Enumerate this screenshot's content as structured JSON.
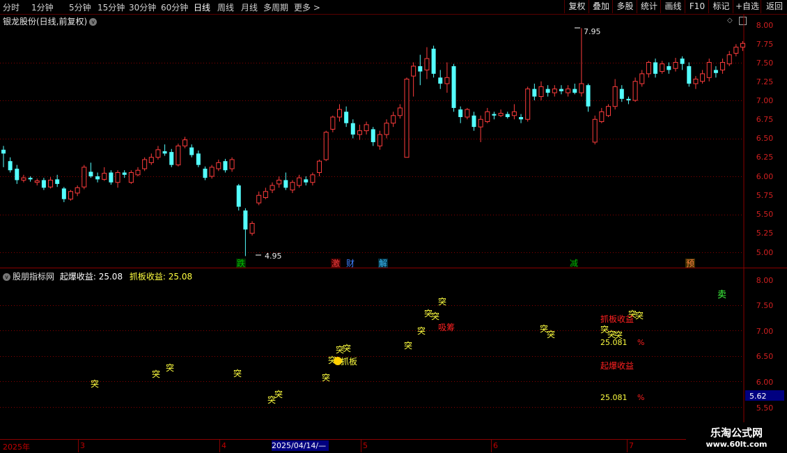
{
  "toolbar": {
    "periods": [
      "分时",
      "1分钟",
      "5分钟",
      "15分钟",
      "30分钟",
      "60分钟",
      "日线",
      "周线",
      "月线",
      "多周期",
      "更多 >"
    ],
    "active_period": "日线",
    "right_buttons": [
      "复权",
      "叠加",
      "多股",
      "统计",
      "画线",
      "F10",
      "标记",
      "+自选",
      "返回"
    ]
  },
  "stock": {
    "title": "银龙股份(日线,前复权)"
  },
  "main_chart": {
    "high_label": "7.95",
    "low_label": "4.95",
    "y_ticks": [
      "8.00",
      "7.75",
      "7.50",
      "7.25",
      "7.00",
      "6.75",
      "6.50",
      "6.25",
      "6.00",
      "5.75",
      "5.50",
      "5.25",
      "5.00"
    ],
    "markers": [
      {
        "text": "跌",
        "color": "#00c000"
      },
      {
        "text": "激",
        "color": "#ff4040"
      },
      {
        "text": "财",
        "color": "#4080ff"
      },
      {
        "text": "解",
        "color": "#40c0ff"
      },
      {
        "text": "减",
        "color": "#00c000"
      },
      {
        "text": "预",
        "color": "#ff8040"
      }
    ]
  },
  "indicator": {
    "name": "股朋指标网",
    "label1": "起爆收益:",
    "value1": "25.08",
    "label2": "抓板收益:",
    "value2": "25.08",
    "y_ticks": [
      "8.00",
      "7.50",
      "7.00",
      "6.50",
      "6.00",
      "5.50"
    ],
    "current_value": "5.62",
    "tu_char": "突",
    "labels": {
      "xichou": "吸筹",
      "zhuaban_inline": "抓板",
      "zhuaban_profit": "抓板收益",
      "qibao_profit": "起爆收益",
      "pct1": "25.081",
      "pct2": "25.081",
      "pct_sign": "%",
      "mai": "卖"
    }
  },
  "dates": {
    "labels": [
      "2025年",
      "3",
      "4",
      "5",
      "6",
      "7"
    ],
    "cursor": "2025/04/14/—"
  },
  "watermark": {
    "line1": "乐淘公式网",
    "line2": "www.60lt.com"
  },
  "colors": {
    "up": "#ff3c3c",
    "down": "#54ffff",
    "grid": "#8a0000",
    "axis": "#c00000",
    "yellow": "#ffff40",
    "red": "#ff2020"
  },
  "chart_data": {
    "type": "candlestick",
    "title": "银龙股份(日线,前复权)",
    "ylim": [
      4.85,
      8.1
    ],
    "candles": [
      [
        6.35,
        6.3,
        6.4,
        6.12
      ],
      [
        6.2,
        6.08,
        6.25,
        6.05
      ],
      [
        6.1,
        5.95,
        6.15,
        5.9
      ],
      [
        5.95,
        5.98,
        6.02,
        5.92
      ],
      [
        5.98,
        5.96,
        6.0,
        5.93
      ],
      [
        5.92,
        5.94,
        5.97,
        5.88
      ],
      [
        5.95,
        5.85,
        5.98,
        5.82
      ],
      [
        5.86,
        5.95,
        5.99,
        5.84
      ],
      [
        5.96,
        5.9,
        6.02,
        5.86
      ],
      [
        5.84,
        5.7,
        5.86,
        5.66
      ],
      [
        5.7,
        5.8,
        5.82,
        5.68
      ],
      [
        5.78,
        5.85,
        5.88,
        5.74
      ],
      [
        5.86,
        6.12,
        6.15,
        5.83
      ],
      [
        6.06,
        6.0,
        6.18,
        5.98
      ],
      [
        6.0,
        5.96,
        6.05,
        5.92
      ],
      [
        5.96,
        6.04,
        6.12,
        5.94
      ],
      [
        6.05,
        5.92,
        6.08,
        5.89
      ],
      [
        5.92,
        6.05,
        6.08,
        5.85
      ],
      [
        6.05,
        6.02,
        6.08,
        5.98
      ],
      [
        5.92,
        6.05,
        6.08,
        5.9
      ],
      [
        6.02,
        6.08,
        6.12,
        6.0
      ],
      [
        6.1,
        6.22,
        6.25,
        6.07
      ],
      [
        6.18,
        6.25,
        6.3,
        6.15
      ],
      [
        6.25,
        6.35,
        6.4,
        6.22
      ],
      [
        6.33,
        6.3,
        6.42,
        6.27
      ],
      [
        6.32,
        6.15,
        6.36,
        6.12
      ],
      [
        6.15,
        6.4,
        6.43,
        6.13
      ],
      [
        6.4,
        6.48,
        6.52,
        6.37
      ],
      [
        6.38,
        6.28,
        6.42,
        6.25
      ],
      [
        6.3,
        6.15,
        6.34,
        6.12
      ],
      [
        6.1,
        5.98,
        6.13,
        5.95
      ],
      [
        6.0,
        6.12,
        6.15,
        5.97
      ],
      [
        6.1,
        6.18,
        6.22,
        6.07
      ],
      [
        6.2,
        6.08,
        6.23,
        6.05
      ],
      [
        6.1,
        6.22,
        6.25,
        6.06
      ],
      [
        5.88,
        5.6,
        5.9,
        5.55
      ],
      [
        5.55,
        5.3,
        5.58,
        4.95
      ],
      [
        5.25,
        5.38,
        5.41,
        5.22
      ],
      [
        5.65,
        5.75,
        5.8,
        5.62
      ],
      [
        5.72,
        5.8,
        5.85,
        5.7
      ],
      [
        5.82,
        5.88,
        5.92,
        5.78
      ],
      [
        5.9,
        5.95,
        6.0,
        5.85
      ],
      [
        5.95,
        5.85,
        6.05,
        5.82
      ],
      [
        5.82,
        5.92,
        5.95,
        5.78
      ],
      [
        5.88,
        5.98,
        6.02,
        5.85
      ],
      [
        5.96,
        5.92,
        6.0,
        5.88
      ],
      [
        5.92,
        6.02,
        6.05,
        5.88
      ],
      [
        6.05,
        6.2,
        6.22,
        6.0
      ],
      [
        6.22,
        6.58,
        6.6,
        6.2
      ],
      [
        6.62,
        6.78,
        6.8,
        6.58
      ],
      [
        6.78,
        6.88,
        6.95,
        6.72
      ],
      [
        6.85,
        6.7,
        6.92,
        6.65
      ],
      [
        6.7,
        6.55,
        6.75,
        6.5
      ],
      [
        6.55,
        6.6,
        6.68,
        6.48
      ],
      [
        6.6,
        6.68,
        6.72,
        6.55
      ],
      [
        6.62,
        6.45,
        6.65,
        6.4
      ],
      [
        6.4,
        6.55,
        6.6,
        6.35
      ],
      [
        6.55,
        6.7,
        6.75,
        6.5
      ],
      [
        6.7,
        6.8,
        6.85,
        6.65
      ],
      [
        6.8,
        6.9,
        6.95,
        6.76
      ],
      [
        6.25,
        7.28,
        7.3,
        6.25
      ],
      [
        7.32,
        7.45,
        7.5,
        7.05
      ],
      [
        7.45,
        7.38,
        7.6,
        7.2
      ],
      [
        7.4,
        7.55,
        7.7,
        7.28
      ],
      [
        7.68,
        7.35,
        7.72,
        7.3
      ],
      [
        7.3,
        7.22,
        7.4,
        7.15
      ],
      [
        7.22,
        7.3,
        7.5,
        7.1
      ],
      [
        7.45,
        6.9,
        7.48,
        6.85
      ],
      [
        6.88,
        6.78,
        6.92,
        6.7
      ],
      [
        6.78,
        6.88,
        6.9,
        6.75
      ],
      [
        6.8,
        6.65,
        6.85,
        6.6
      ],
      [
        6.65,
        6.75,
        6.8,
        6.45
      ],
      [
        6.72,
        6.85,
        6.9,
        6.7
      ],
      [
        6.82,
        6.8,
        6.85,
        6.75
      ],
      [
        6.8,
        6.83,
        6.88,
        6.78
      ],
      [
        6.82,
        6.78,
        6.85,
        6.76
      ],
      [
        6.8,
        6.85,
        6.95,
        6.75
      ],
      [
        6.78,
        6.75,
        6.82,
        6.7
      ],
      [
        6.75,
        7.15,
        7.18,
        6.72
      ],
      [
        7.15,
        7.05,
        7.22,
        7.0
      ],
      [
        7.05,
        7.18,
        7.25,
        7.0
      ],
      [
        7.15,
        7.1,
        7.2,
        7.05
      ],
      [
        7.1,
        7.15,
        7.2,
        7.05
      ],
      [
        7.15,
        7.12,
        7.2,
        7.08
      ],
      [
        7.1,
        7.15,
        7.2,
        7.05
      ],
      [
        7.15,
        7.1,
        7.22,
        7.08
      ],
      [
        7.1,
        7.22,
        7.95,
        7.05
      ],
      [
        7.2,
        6.92,
        7.22,
        6.85
      ],
      [
        6.45,
        6.75,
        6.8,
        6.42
      ],
      [
        6.72,
        6.85,
        6.9,
        6.7
      ],
      [
        6.8,
        6.92,
        6.95,
        6.78
      ],
      [
        6.92,
        7.18,
        7.28,
        6.88
      ],
      [
        7.15,
        7.02,
        7.2,
        6.98
      ],
      [
        7.02,
        7.0,
        7.05,
        6.95
      ],
      [
        7.0,
        7.25,
        7.3,
        6.98
      ],
      [
        7.22,
        7.35,
        7.4,
        7.18
      ],
      [
        7.35,
        7.5,
        7.52,
        7.3
      ],
      [
        7.5,
        7.35,
        7.55,
        7.3
      ],
      [
        7.38,
        7.48,
        7.52,
        7.35
      ],
      [
        7.45,
        7.4,
        7.5,
        7.35
      ],
      [
        7.42,
        7.5,
        7.56,
        7.38
      ],
      [
        7.55,
        7.48,
        7.58,
        7.4
      ],
      [
        7.45,
        7.22,
        7.5,
        7.18
      ],
      [
        7.22,
        7.28,
        7.32,
        7.15
      ],
      [
        7.25,
        7.35,
        7.4,
        7.22
      ],
      [
        7.3,
        7.5,
        7.55,
        7.25
      ],
      [
        7.4,
        7.36,
        7.45,
        7.3
      ],
      [
        7.4,
        7.5,
        7.55,
        7.35
      ],
      [
        7.48,
        7.6,
        7.65,
        7.45
      ],
      [
        7.62,
        7.7,
        7.74,
        7.58
      ],
      [
        7.7,
        7.75,
        7.78,
        7.65
      ]
    ]
  }
}
